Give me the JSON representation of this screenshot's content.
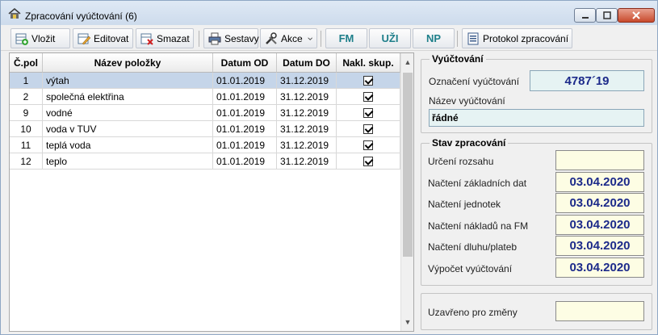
{
  "window": {
    "title": "Zpracování vyúčtování",
    "count": "(6)"
  },
  "toolbar": {
    "vlozit": "Vložit",
    "editovat": "Editovat",
    "smazat": "Smazat",
    "sestavy": "Sestavy",
    "akce": "Akce",
    "fm": "FM",
    "uzi": "UŽI",
    "np": "NP",
    "protokol": "Protokol zpracování"
  },
  "grid": {
    "headers": [
      "Č.pol",
      "Název položky",
      "Datum OD",
      "Datum DO",
      "Nakl. skup."
    ],
    "rows": [
      {
        "cpol": "1",
        "nazev": "výtah",
        "od": "01.01.2019",
        "do": "31.12.2019",
        "checked": true,
        "selected": true
      },
      {
        "cpol": "2",
        "nazev": "společná elektřina",
        "od": "01.01.2019",
        "do": "31.12.2019",
        "checked": true
      },
      {
        "cpol": "9",
        "nazev": "vodné",
        "od": "01.01.2019",
        "do": "31.12.2019",
        "checked": true
      },
      {
        "cpol": "10",
        "nazev": "voda v TUV",
        "od": "01.01.2019",
        "do": "31.12.2019",
        "checked": true
      },
      {
        "cpol": "11",
        "nazev": "teplá voda",
        "od": "01.01.2019",
        "do": "31.12.2019",
        "checked": true
      },
      {
        "cpol": "12",
        "nazev": "teplo",
        "od": "01.01.2019",
        "do": "31.12.2019",
        "checked": true
      }
    ]
  },
  "vyuctovani": {
    "title": "Vyúčtování",
    "oznaceni_label": "Označení vyúčtování",
    "oznaceni_value": "4787´19",
    "nazev_label": "Název vyúčtování",
    "nazev_value": "řádné"
  },
  "stav": {
    "title": "Stav zpracování",
    "items": [
      {
        "label": "Určení rozsahu",
        "value": ""
      },
      {
        "label": "Načtení základních dat",
        "value": "03.04.2020"
      },
      {
        "label": "Načtení jednotek",
        "value": "03.04.2020"
      },
      {
        "label": "Načtení nákladů na FM",
        "value": "03.04.2020"
      },
      {
        "label": "Načtení dluhu/plateb",
        "value": "03.04.2020"
      },
      {
        "label": "Výpočet vyúčtování",
        "value": "03.04.2020"
      }
    ]
  },
  "uzavreno": {
    "label": "Uzavřeno pro změny",
    "value": ""
  },
  "colors": {
    "accent_teal": "#1e7f8a",
    "date_text": "#1c2a8a",
    "selected_row": "#c5d5e9"
  }
}
